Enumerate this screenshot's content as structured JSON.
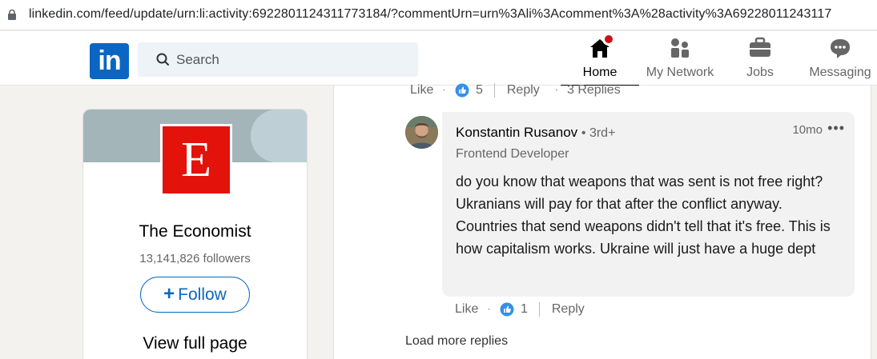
{
  "browser": {
    "url": "linkedin.com/feed/update/urn:li:activity:6922801124311773184/?commentUrn=urn%3Ali%3Acomment%3A%28activity%3A69228011243117"
  },
  "nav": {
    "search_placeholder": "Search",
    "items": [
      {
        "label": "Home",
        "icon": "home-icon",
        "active": true
      },
      {
        "label": "My Network",
        "icon": "network-icon"
      },
      {
        "label": "Jobs",
        "icon": "briefcase-icon"
      },
      {
        "label": "Messaging",
        "icon": "messaging-icon"
      }
    ],
    "logo_text": "in"
  },
  "company_card": {
    "logo_letter": "E",
    "name": "The Economist",
    "followers": "13,141,826 followers",
    "follow_plus": "+",
    "follow_label": "Follow",
    "view_full_page": "View full page"
  },
  "parent_comment_actions": {
    "like": "Like",
    "dot": "·",
    "reactions": "5",
    "reply": "Reply",
    "replies": "3 Replies"
  },
  "reply": {
    "author": "Konstantin Rusanov",
    "degree": "• 3rd+",
    "headline": "Frontend Developer",
    "time": "10mo",
    "more": "•••",
    "text": "do you know that weapons that was sent is not free right? Ukranians will pay for that after the conflict anyway. Countries that send weapons didn't tell that it's free. This is how capitalism works. Ukraine will just have a huge dept",
    "actions": {
      "like": "Like",
      "dot": "·",
      "reactions": "1",
      "reply": "Reply"
    }
  },
  "load_more": "Load more replies",
  "colors": {
    "brand": "#0a66c2",
    "economist_red": "#e3120b",
    "notification_badge": "#cc1016"
  }
}
